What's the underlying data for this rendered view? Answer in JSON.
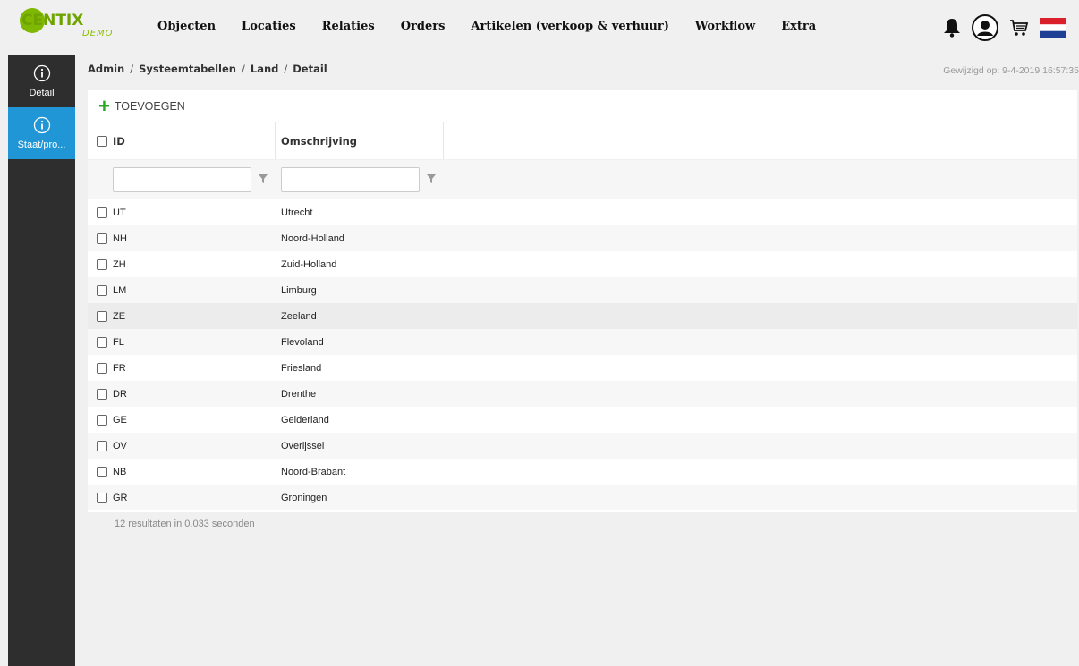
{
  "app": {
    "logo_text": "CENTIX",
    "logo_sub": "DEMO"
  },
  "nav": {
    "items": [
      {
        "label": "Objecten"
      },
      {
        "label": "Locaties"
      },
      {
        "label": "Relaties"
      },
      {
        "label": "Orders"
      },
      {
        "label": "Artikelen (verkoop & verhuur)"
      },
      {
        "label": "Workflow"
      },
      {
        "label": "Extra"
      }
    ],
    "icons": [
      "bell-icon",
      "user-icon",
      "cart-icon",
      "flag-nl-icon"
    ]
  },
  "sidebar": {
    "items": [
      {
        "label": "Detail",
        "icon": "info-icon",
        "active": false
      },
      {
        "label": "Staat/pro...",
        "icon": "info-icon",
        "active": true
      }
    ]
  },
  "breadcrumb": {
    "items": [
      "Admin",
      "Systeemtabellen",
      "Land",
      "Detail"
    ]
  },
  "modified": "Gewijzigd op: 9-4-2019 16:57:35",
  "toolbar": {
    "add_label": "TOEVOEGEN"
  },
  "table": {
    "columns": [
      "ID",
      "Omschrijving"
    ],
    "filter_placeholders": [
      "",
      ""
    ],
    "rows": [
      {
        "id": "UT",
        "desc": "Utrecht"
      },
      {
        "id": "NH",
        "desc": "Noord-Holland"
      },
      {
        "id": "ZH",
        "desc": "Zuid-Holland"
      },
      {
        "id": "LM",
        "desc": "Limburg"
      },
      {
        "id": "ZE",
        "desc": "Zeeland"
      },
      {
        "id": "FL",
        "desc": "Flevoland"
      },
      {
        "id": "FR",
        "desc": "Friesland"
      },
      {
        "id": "DR",
        "desc": "Drenthe"
      },
      {
        "id": "GE",
        "desc": "Gelderland"
      },
      {
        "id": "OV",
        "desc": "Overijssel"
      },
      {
        "id": "NB",
        "desc": "Noord-Brabant"
      },
      {
        "id": "GR",
        "desc": "Groningen"
      }
    ]
  },
  "result_count": "12 resultaten in 0.033 seconden",
  "colors": {
    "accent": "#2196d6",
    "sidebar_bg": "#2e2e2e",
    "add_green": "#2ba62b",
    "logo_green": "#7fb800"
  }
}
